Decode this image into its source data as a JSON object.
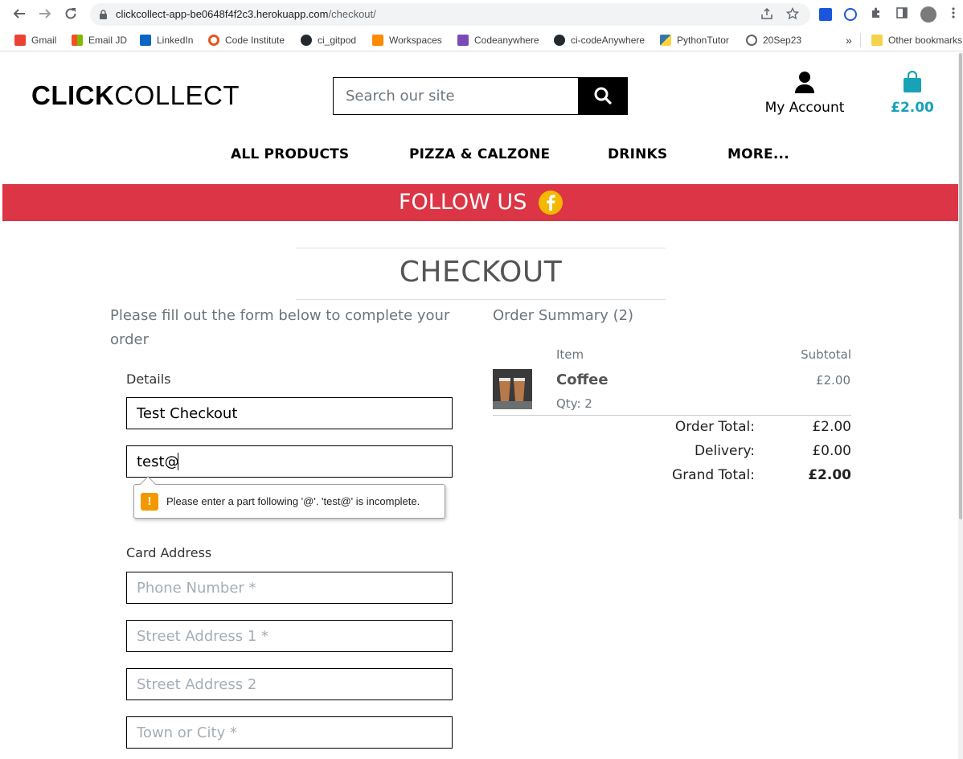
{
  "browser": {
    "url_host": "clickcollect-app-be0648f4f2c3.herokuapp.com",
    "url_path": "/checkout/",
    "bookmarks": [
      {
        "label": "Gmail",
        "icon": "gmail-icon",
        "color": "#ea4335"
      },
      {
        "label": "Email JD",
        "icon": "microsoft-icon",
        "color": "#f25022"
      },
      {
        "label": "LinkedIn",
        "icon": "linkedin-icon",
        "color": "#0a66c2"
      },
      {
        "label": "Code Institute",
        "icon": "code-institute-icon",
        "color": "#e95420"
      },
      {
        "label": "ci_gitpod",
        "icon": "github-icon",
        "color": "#24292f"
      },
      {
        "label": "Workspaces",
        "icon": "gitpod-icon",
        "color": "#ff8a00"
      },
      {
        "label": "Codeanywhere",
        "icon": "codeanywhere-icon",
        "color": "#7b4bb5"
      },
      {
        "label": "ci-codeAnywhere",
        "icon": "github-icon",
        "color": "#24292f"
      },
      {
        "label": "PythonTutor",
        "icon": "python-icon",
        "color": "#3776ab"
      },
      {
        "label": "20Sep23",
        "icon": "history-icon",
        "color": "#5f6368"
      }
    ],
    "overflow": "»",
    "other_bookmarks": "Other bookmarks"
  },
  "site": {
    "logo_bold": "CLICK",
    "logo_light": "COLLECT",
    "search_placeholder": "Search our site",
    "account_label": "My Account",
    "bag_total": "£2.00",
    "nav": [
      "ALL PRODUCTS",
      "PIZZA & CALZONE",
      "DRINKS",
      "MORE..."
    ],
    "banner_text": "FOLLOW US",
    "accent_color": "#17a2b8",
    "banner_color": "#dc3545"
  },
  "checkout": {
    "title": "CHECKOUT",
    "intro": "Please fill out the form below to complete your order",
    "details_label": "Details",
    "full_name_value": "Test Checkout",
    "email_value": "test@",
    "validation_message": "Please enter a part following '@'. 'test@' is incomplete.",
    "address_label": "Card Address",
    "phone_placeholder": "Phone Number *",
    "street1_placeholder": "Street Address 1 *",
    "street2_placeholder": "Street Address 2",
    "town_placeholder": "Town or City *"
  },
  "summary": {
    "title": "Order Summary (2)",
    "col_item": "Item",
    "col_subtotal": "Subtotal",
    "item_name": "Coffee",
    "item_qty": "Qty: 2",
    "item_subtotal": "£2.00",
    "order_total_label": "Order Total:",
    "order_total": "£2.00",
    "delivery_label": "Delivery:",
    "delivery": "£0.00",
    "grand_total_label": "Grand Total:",
    "grand_total": "£2.00"
  }
}
